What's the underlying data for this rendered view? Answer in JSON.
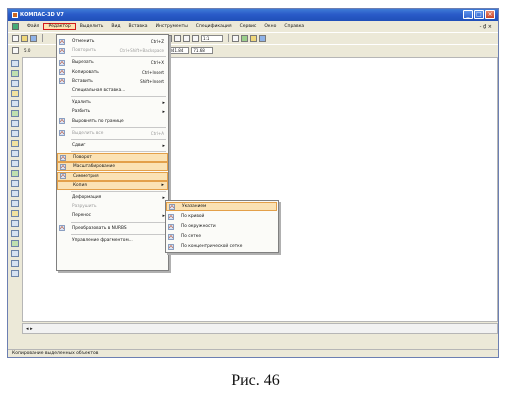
{
  "window": {
    "title": "КОМПАС-3D V7",
    "controls": [
      "_",
      "□",
      "×"
    ]
  },
  "menubar": {
    "items": [
      {
        "label": "Файл"
      },
      {
        "label": "Редактор",
        "active": true
      },
      {
        "label": "Выделить"
      },
      {
        "label": "Вид"
      },
      {
        "label": "Вставка"
      },
      {
        "label": "Инструменты"
      },
      {
        "label": "Спецификация"
      },
      {
        "label": "Сервис"
      },
      {
        "label": "Окно"
      },
      {
        "label": "Справка"
      }
    ],
    "right_controls": "- ₫ ×"
  },
  "toolbar": {
    "zoom_value": "1:1",
    "step_label": "5.0",
    "coord_field_1": "341.84",
    "coord_field_2": "71.68"
  },
  "edit_menu": {
    "items": [
      {
        "icon": "undo-icon",
        "label": "Отменить",
        "shortcut": "Ctrl+Z"
      },
      {
        "icon": "redo-icon",
        "label": "Повторить",
        "shortcut": "Ctrl+Shift+Backspace",
        "disabled": true
      },
      {
        "type": "separator"
      },
      {
        "icon": "cut-icon",
        "label": "Вырезать",
        "shortcut": "Ctrl+X"
      },
      {
        "icon": "copy-icon",
        "label": "Копировать",
        "shortcut": "Ctrl+Insert"
      },
      {
        "icon": "paste-icon",
        "label": "Вставить",
        "shortcut": "Shift+Insert"
      },
      {
        "label": "Специальная вставка..."
      },
      {
        "type": "separator"
      },
      {
        "label": "Удалить",
        "submenu": true
      },
      {
        "label": "Разбить",
        "submenu": true
      },
      {
        "icon": "align-icon",
        "label": "Выровнять по границе"
      },
      {
        "type": "separator"
      },
      {
        "icon": "select-all-icon",
        "label": "Выделить все",
        "shortcut": "Ctrl+A",
        "disabled": true
      },
      {
        "type": "separator"
      },
      {
        "label": "Сдвиг",
        "submenu": true
      },
      {
        "type": "separator"
      },
      {
        "icon": "rotate-icon",
        "label": "Поворот",
        "highlight": true
      },
      {
        "icon": "scale-icon",
        "label": "Масштабирование",
        "highlight": true
      },
      {
        "icon": "symmetry-icon",
        "label": "Симметрия",
        "highlight": true
      },
      {
        "label": "Копия",
        "submenu": true,
        "highlight": true
      },
      {
        "type": "separator"
      },
      {
        "label": "Деформация",
        "submenu": true
      },
      {
        "label": "Разрушить",
        "disabled": true
      },
      {
        "label": "Перенос",
        "submenu": true
      },
      {
        "type": "separator"
      },
      {
        "icon": "nurbs-icon",
        "label": "Преобразовать в NURBS"
      },
      {
        "type": "separator"
      },
      {
        "label": "Управление фрагментом..."
      }
    ]
  },
  "copy_submenu": {
    "items": [
      {
        "icon": "copy-arrow-icon",
        "label": "Указанием",
        "highlight": true
      },
      {
        "icon": "copy-along-curve-icon",
        "label": "По кривой"
      },
      {
        "icon": "copy-circle-icon",
        "label": "По окружности"
      },
      {
        "icon": "copy-grid-icon",
        "label": "По сетке"
      },
      {
        "icon": "copy-concentric-icon",
        "label": "По концентрической сетке"
      }
    ]
  },
  "statusbar": {
    "text": "Копирование выделенных объектов"
  },
  "caption": "Рис. 46",
  "colors": {
    "titlebar": "#2a5bc8",
    "menu_highlight": "#fbe2b4",
    "active_menu_border": "#d21a1a"
  }
}
